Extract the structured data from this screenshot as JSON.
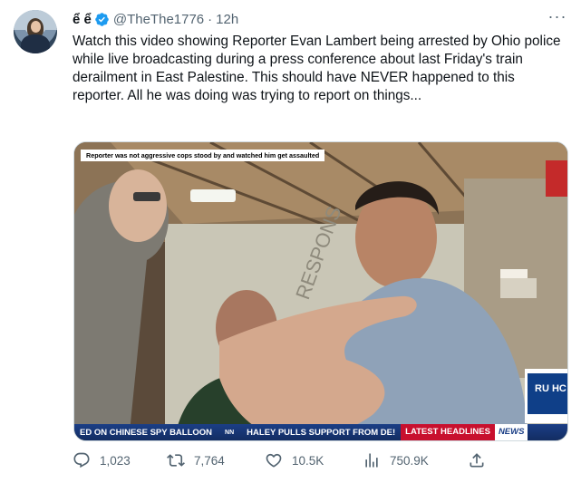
{
  "author": {
    "name": "ể  ể",
    "handle": "@TheThe1776",
    "separator": "·",
    "time": "12h"
  },
  "more_label": "···",
  "tweet_text": "Watch this video showing Reporter Evan Lambert being arrested by Ohio police while live broadcasting during a press conference about last Friday's train derailment in East Palestine. This should have NEVER happened to this reporter. All he was doing was trying to report on things...",
  "media": {
    "caption": "Reporter was not aggressive cops stood by and watched him get assaulted",
    "wall_text": "RESPONS",
    "ticker": {
      "segment1": "ED ON CHINESE SPY BALLOON",
      "network": "NN",
      "segment2": "HALEY PULLS SUPPORT FROM DE!",
      "latest": "LATEST HEADLINES",
      "news": "NEWS"
    },
    "side_label": "RU HC"
  },
  "actions": {
    "replies": "1,023",
    "retweets": "7,764",
    "likes": "10.5K",
    "views": "750.9K"
  },
  "colors": {
    "verified": "#1d9bf0",
    "muted": "#536471",
    "text": "#0f1419",
    "ticker_blue": "#1b3f86",
    "ticker_red": "#c8102e"
  }
}
